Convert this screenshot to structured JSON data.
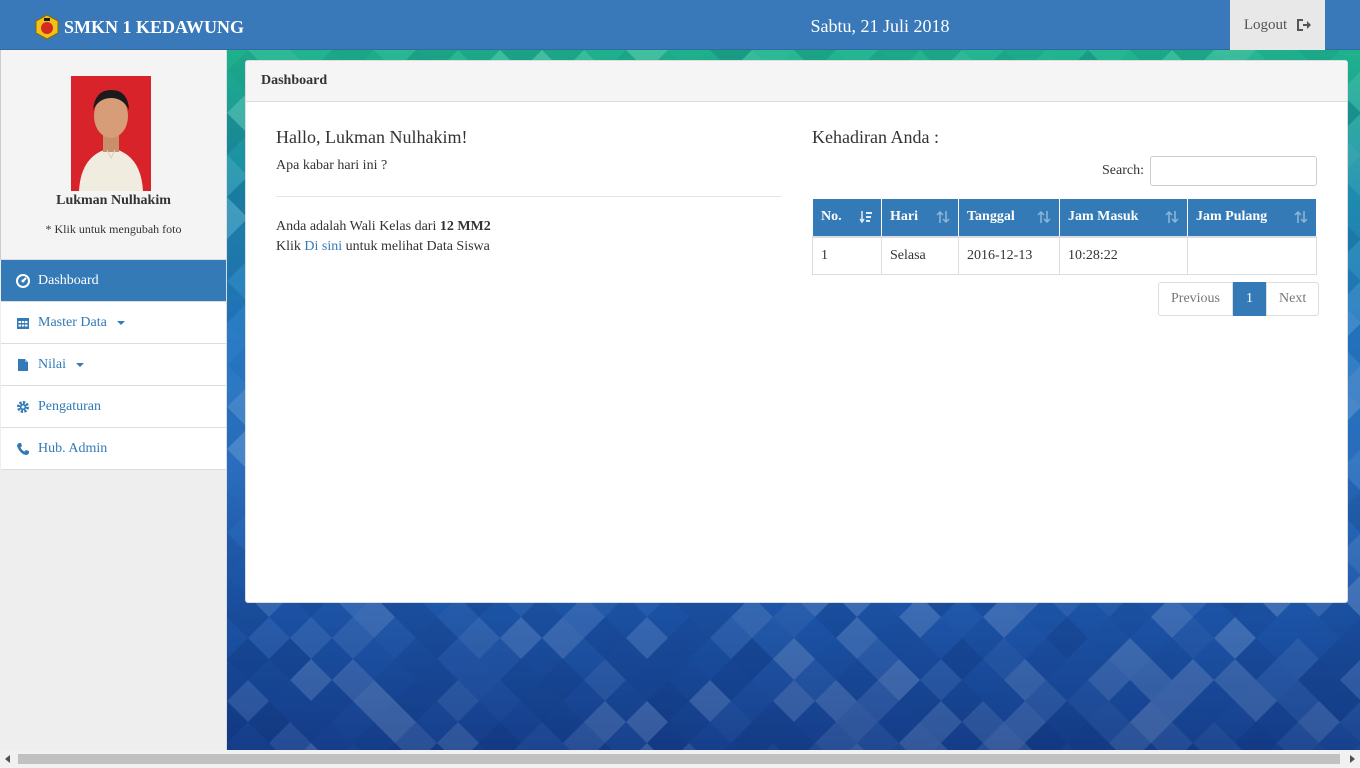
{
  "navbar": {
    "brand": "SMKN 1 KEDAWUNG",
    "date": "Sabtu, 21 Juli 2018",
    "logout_label": "Logout"
  },
  "sidebar": {
    "name": "Lukman Nulhakim",
    "hint": "* Klik untuk mengubah foto",
    "items": [
      {
        "label": "Dashboard",
        "icon": "dashboard-icon"
      },
      {
        "label": "Master Data",
        "icon": "calendar-icon"
      },
      {
        "label": "Nilai",
        "icon": "file-icon"
      },
      {
        "label": "Pengaturan",
        "icon": "gear-icon"
      },
      {
        "label": "Hub. Admin",
        "icon": "phone-icon"
      }
    ]
  },
  "panel": {
    "title": "Dashboard",
    "greeting": "Hallo, Lukman Nulhakim!",
    "sub": "Apa kabar hari ini ?",
    "info_prefix": "Anda adalah Wali Kelas dari",
    "info_class": "12 MM2",
    "link_prefix": "Klik",
    "link_text": "Di sini",
    "link_suffix": "untuk melihat Data Siswa"
  },
  "attendance": {
    "title": "Kehadiran Anda :",
    "search_label": "Search:",
    "columns": [
      "No.",
      "Hari",
      "Tanggal",
      "Jam Masuk",
      "Jam Pulang"
    ],
    "rows": [
      [
        "1",
        "Selasa",
        "2016-12-13",
        "10:28:22",
        ""
      ]
    ],
    "pager": {
      "previous": "Previous",
      "current": "1",
      "next": "Next"
    }
  },
  "colors": {
    "primary": "#337ab7",
    "navbar": "#3a79b9"
  }
}
